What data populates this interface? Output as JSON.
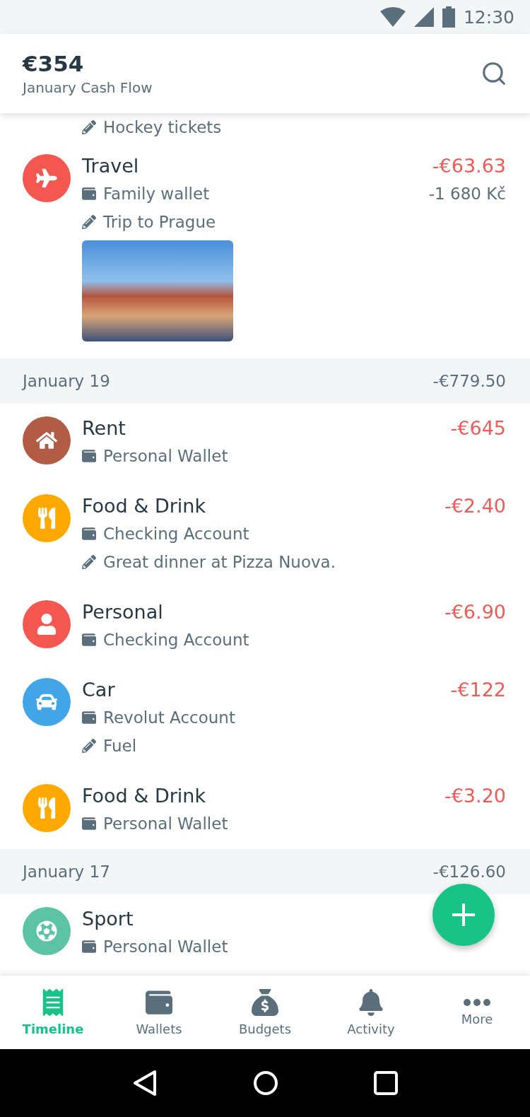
{
  "status_bar": {
    "time": "12:30"
  },
  "header": {
    "amount": "€354",
    "subtitle": "January Cash Flow"
  },
  "leading_note": "Hockey tickets",
  "sections": [
    {
      "items": [
        {
          "category": "Travel",
          "kind": "plane",
          "color": "#f4574f",
          "wallet": "Family wallet",
          "note": "Trip to Prague",
          "amount": "-€63.63",
          "amount_secondary": "-1 680 Kč",
          "photo": true
        }
      ]
    },
    {
      "date": "January 19",
      "total": "-€779.50",
      "items": [
        {
          "category": "Rent",
          "kind": "home",
          "color": "#b35c45",
          "wallet": "Personal Wallet",
          "amount": "-€645"
        },
        {
          "category": "Food & Drink",
          "kind": "food",
          "color": "#ffa800",
          "wallet": "Checking Account",
          "note": "Great dinner at Pizza Nuova.",
          "amount": "-€2.40"
        },
        {
          "category": "Personal",
          "kind": "person",
          "color": "#f4574f",
          "wallet": "Checking Account",
          "amount": "-€6.90"
        },
        {
          "category": "Car",
          "kind": "car",
          "color": "#42a5e8",
          "wallet": "Revolut Account",
          "note": "Fuel",
          "amount": "-€122"
        },
        {
          "category": "Food & Drink",
          "kind": "food",
          "color": "#ffa800",
          "wallet": "Personal Wallet",
          "amount": "-€3.20"
        }
      ]
    },
    {
      "date": "January 17",
      "total": "-€126.60",
      "items": [
        {
          "category": "Sport",
          "kind": "ball",
          "color": "#5cc4a3",
          "wallet": "Personal Wallet"
        }
      ]
    }
  ],
  "tabs": [
    {
      "label": "Timeline",
      "kind": "receipt",
      "selected": true
    },
    {
      "label": "Wallets",
      "kind": "wallet",
      "selected": false
    },
    {
      "label": "Budgets",
      "kind": "bag",
      "selected": false
    },
    {
      "label": "Activity",
      "kind": "bell",
      "selected": false
    },
    {
      "label": "More",
      "kind": "dots",
      "selected": false
    }
  ]
}
